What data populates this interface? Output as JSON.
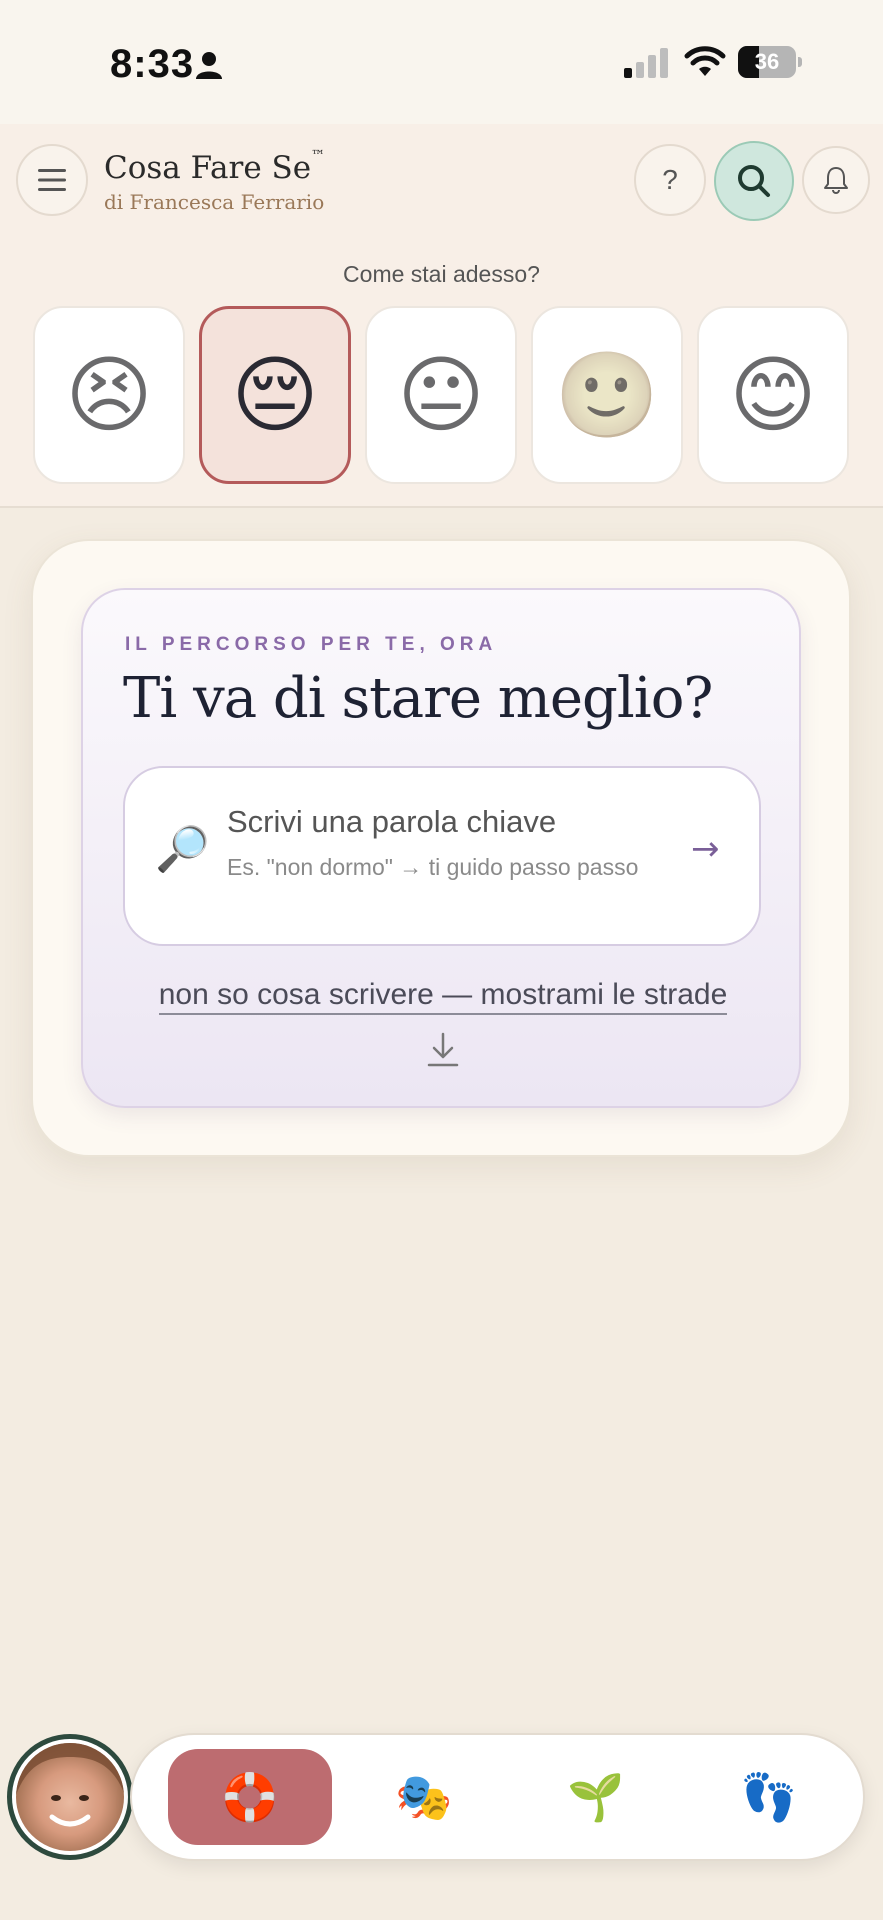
{
  "status_bar": {
    "time": "8:33",
    "battery": "36",
    "battery_level": 0.36
  },
  "header": {
    "app_title": "Cosa Fare Se",
    "trademark": "™",
    "subtitle": "di Francesca Ferrario",
    "help_label": "?"
  },
  "mood": {
    "prompt": "Come stai adesso?",
    "options": [
      "😣",
      "😔",
      "😐",
      "🙂",
      "😊"
    ],
    "selected_index": 1
  },
  "path_card": {
    "eyebrow": "IL PERCORSO PER TE, ORA",
    "title": "Ti va di stare meglio?",
    "search": {
      "icon": "🔎",
      "label": "Scrivi una parola chiave",
      "hint": "Es. \"non dormo\" → ti guido passo passo",
      "arrow": "→"
    },
    "show_paths_link": "non so cosa scrivere — mostrami le strade"
  },
  "bottom_nav": {
    "items": [
      {
        "icon": "🛟",
        "name": "lifebuoy"
      },
      {
        "icon": "🎭",
        "name": "theater-masks"
      },
      {
        "icon": "🌱",
        "name": "seedling"
      },
      {
        "icon": "👣",
        "name": "footprints"
      }
    ],
    "active_index": 0
  },
  "colors": {
    "accent_nav": "#bd6c70",
    "search_button": "#cfe7dd",
    "eyebrow": "#8a6aa8",
    "selected_mood_border": "#b45a5a"
  }
}
